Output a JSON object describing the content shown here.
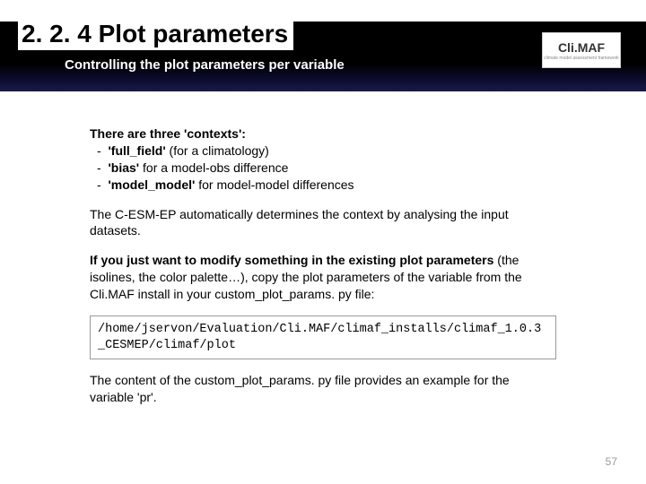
{
  "header": {
    "title": "2. 2. 4 Plot parameters",
    "subtitle": "Controlling the plot parameters per variable",
    "logo_text": "Cli.MAF",
    "logo_sub": "climate model assessment framework"
  },
  "body": {
    "contexts_intro": "There are three 'contexts':",
    "contexts": [
      {
        "name": "'full_field'",
        "desc": " (for a climatology)"
      },
      {
        "name": "'bias'",
        "desc": " for a model-obs difference"
      },
      {
        "name": "'model_model'",
        "desc": " for model-model differences"
      }
    ],
    "para_auto": "The C-ESM-EP automatically determines the context by analysing the input datasets.",
    "para_modify_bold": "If you just want to modify something in the existing plot parameters",
    "para_modify_rest": " (the isolines, the color palette…), copy the plot parameters of the variable from the Cli.MAF install in your custom_plot_params. py file:",
    "code_path": "/home/jservon/Evaluation/Cli.MAF/climaf_installs/climaf_1.0.3_CESMEP/climaf/plot",
    "para_outro": "The content of the custom_plot_params. py file provides an example for the variable 'pr'."
  },
  "page_number": "57"
}
